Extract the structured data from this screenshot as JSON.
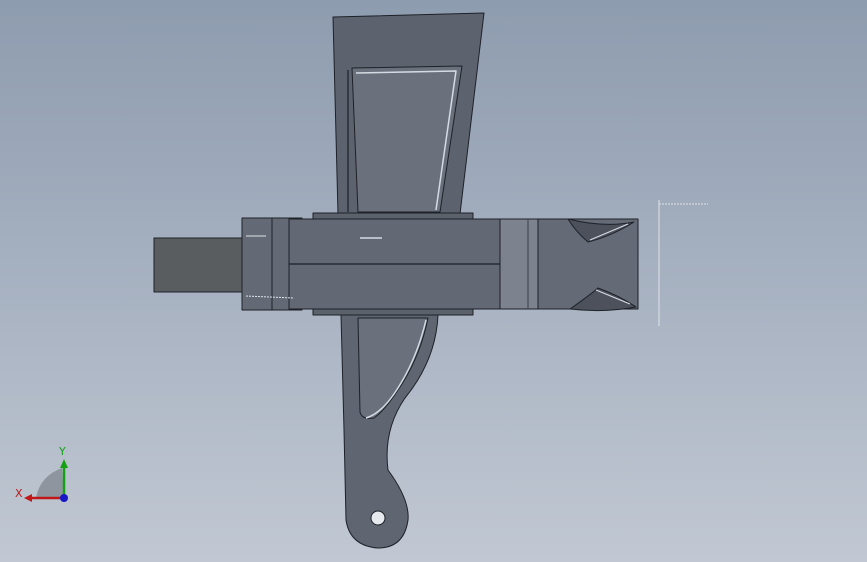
{
  "viewport": {
    "background_top": "#8e9caf",
    "background_bottom": "#c1c8d3"
  },
  "model": {
    "body_color": "#626874",
    "body_dark": "#4c515c",
    "edge_color": "#1e2127",
    "highlight_color": "#d6dbe3",
    "shaft_color": "#5a5d5f"
  },
  "triad": {
    "x_label": "X",
    "y_label": "Y",
    "x_color": "#c01818",
    "y_color": "#16a016",
    "z_color": "#1818c8"
  }
}
